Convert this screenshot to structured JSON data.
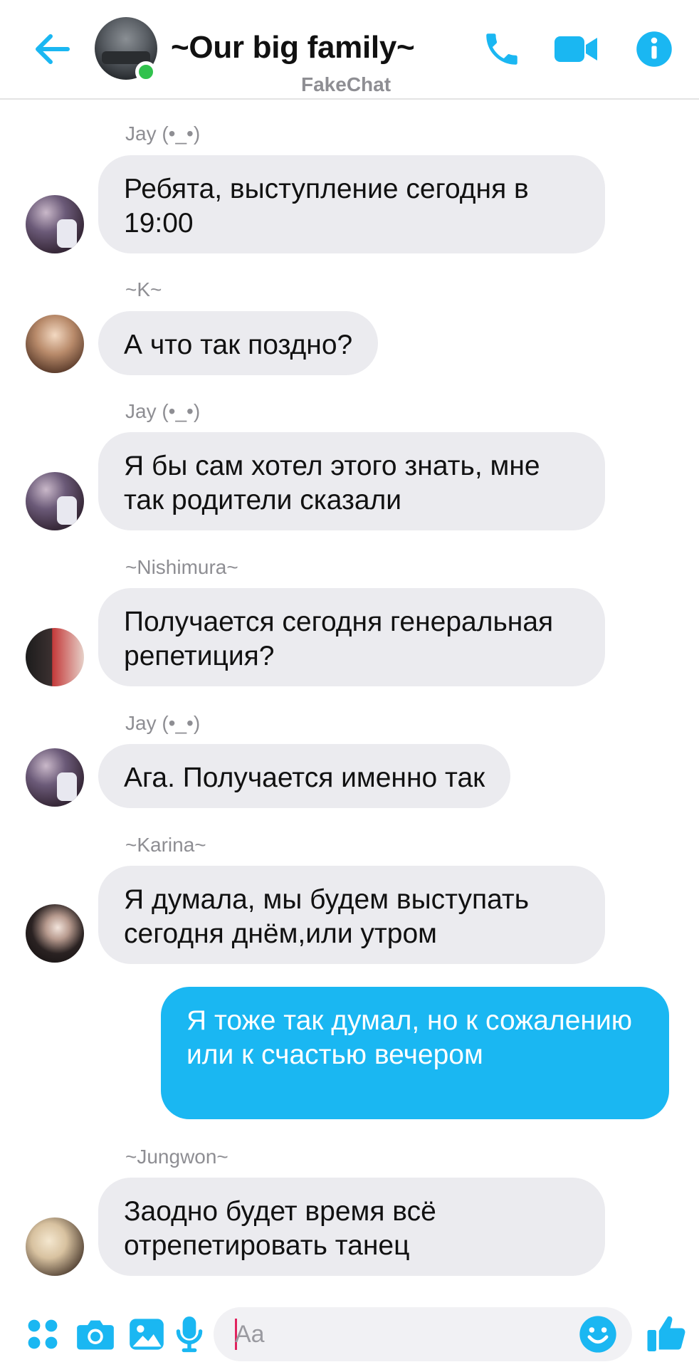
{
  "header": {
    "title": "~Our big family~",
    "subtitle": "FakeChat",
    "accent_color": "#1ab7f2",
    "online_color": "#31c24d",
    "icons": [
      "back-arrow-icon",
      "phone-icon",
      "video-camera-icon",
      "info-icon"
    ]
  },
  "messages": [
    {
      "sender": "Jay (•_•)",
      "text": "Ребята, выступление сегодня в 19:00",
      "direction": "incoming"
    },
    {
      "sender": "~K~",
      "text": "А что так поздно?",
      "direction": "incoming"
    },
    {
      "sender": "Jay (•_•)",
      "text": "Я бы сам хотел этого знать, мне так родители сказали",
      "direction": "incoming"
    },
    {
      "sender": "~Nishimura~",
      "text": "Получается сегодня генеральная репетиция?",
      "direction": "incoming"
    },
    {
      "sender": "Jay (•_•)",
      "text": "Ага. Получается именно так",
      "direction": "incoming"
    },
    {
      "sender": "~Karina~",
      "text": "Я думала, мы будем выступать сегодня днём,или утром",
      "direction": "incoming"
    },
    {
      "sender": "",
      "text": "Я тоже так думал, но к сожалению или к счастью вечером",
      "direction": "outgoing"
    },
    {
      "sender": "~Jungwon~",
      "text": "Заодно будет время всё отрепетировать танец",
      "direction": "incoming"
    }
  ],
  "composer": {
    "placeholder": "Aa",
    "icons": [
      "apps-grid-icon",
      "camera-icon",
      "gallery-icon",
      "microphone-icon",
      "emoji-icon",
      "thumbs-up-icon"
    ]
  },
  "colors": {
    "incoming_bubble": "#ebebef",
    "outgoing_bubble": "#1ab7f2",
    "sender_label": "#8e8e93"
  }
}
